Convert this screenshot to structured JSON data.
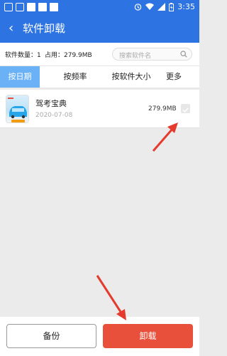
{
  "statusbar": {
    "time": "3:35"
  },
  "appbar": {
    "back_glyph": "‹",
    "title": "软件卸载"
  },
  "info": {
    "count": "软件数量：1",
    "used": "占用：279.9MB",
    "search_placeholder": "搜索软件名"
  },
  "tabs": [
    {
      "label": "按日期",
      "active": true
    },
    {
      "label": "按频率",
      "active": false
    },
    {
      "label": "按软件大小",
      "active": false
    },
    {
      "label": "更多",
      "active": false
    }
  ],
  "apps": [
    {
      "name": "驾考宝典",
      "date": "2020-07-08",
      "size": "279.9MB",
      "checked": false
    }
  ],
  "buttons": {
    "backup": "备份",
    "uninstall": "卸载"
  },
  "colors": {
    "primary": "#2d73e1",
    "active_tab": "#6ab1f5",
    "danger": "#e9503b",
    "arrow": "#e53a2e"
  }
}
